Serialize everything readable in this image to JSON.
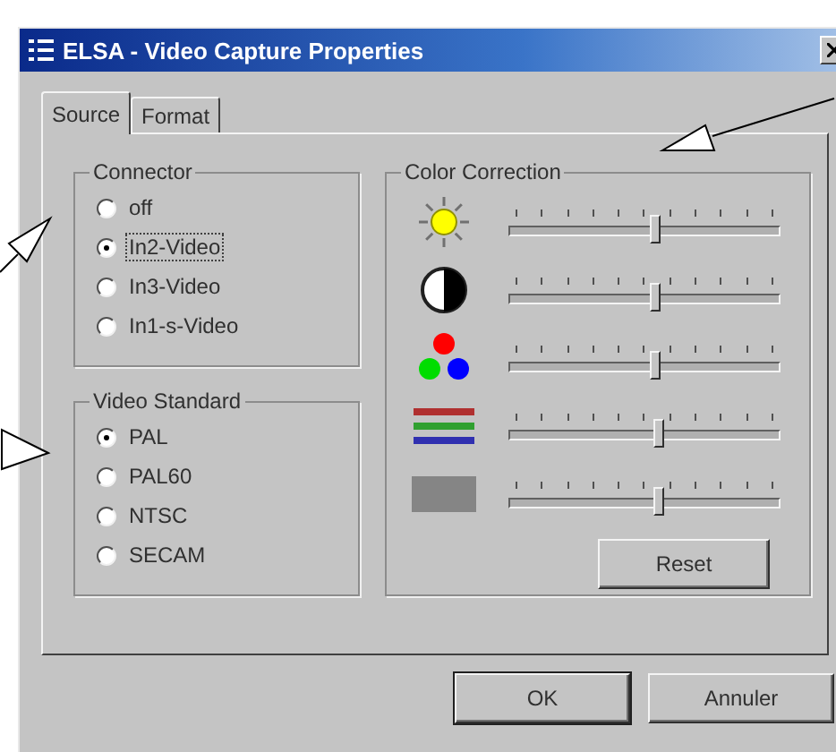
{
  "window": {
    "title": "ELSA - Video Capture Properties"
  },
  "tabs": [
    {
      "label": "Source",
      "selected": true
    },
    {
      "label": "Format",
      "selected": false
    }
  ],
  "connector": {
    "title": "Connector",
    "options": [
      {
        "label": "off",
        "selected": false,
        "focused": false
      },
      {
        "label": "In2-Video",
        "selected": true,
        "focused": true
      },
      {
        "label": "In3-Video",
        "selected": false,
        "focused": false
      },
      {
        "label": "In1-s-Video",
        "selected": false,
        "focused": false
      }
    ]
  },
  "video_standard": {
    "title": "Video Standard",
    "options": [
      {
        "label": "PAL",
        "selected": true,
        "focused": false
      },
      {
        "label": "PAL60",
        "selected": false,
        "focused": false
      },
      {
        "label": "NTSC",
        "selected": false,
        "focused": false
      },
      {
        "label": "SECAM",
        "selected": false,
        "focused": false
      }
    ]
  },
  "color_correction": {
    "title": "Color Correction",
    "sliders": [
      {
        "kind": "brightness",
        "level": 0.54
      },
      {
        "kind": "contrast",
        "level": 0.54
      },
      {
        "kind": "color",
        "level": 0.54
      },
      {
        "kind": "tint",
        "level": 0.55
      },
      {
        "kind": "gray",
        "level": 0.55
      }
    ],
    "reset": "Reset"
  },
  "buttons": [
    {
      "label": "OK",
      "default": true
    },
    {
      "label": "Annuler",
      "default": false
    }
  ]
}
